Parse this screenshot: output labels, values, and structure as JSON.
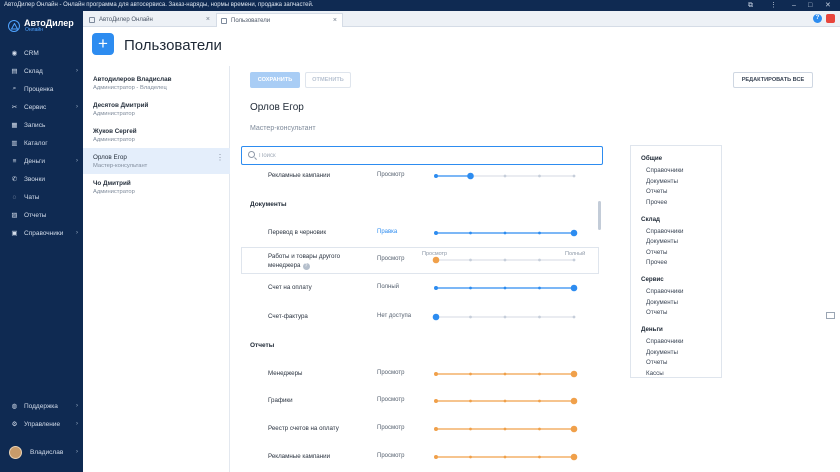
{
  "window": {
    "title": "АвтоДилер Онлайн - Онлайн программа для автосервиса. Заказ-наряды, нормы времени, продажа запчастей."
  },
  "tabs": [
    {
      "label": "АвтоДилер Онлайн",
      "active": false
    },
    {
      "label": "Пользователи",
      "active": true
    }
  ],
  "brand": {
    "name": "АвтоДилер",
    "sub": "Онлайн",
    "accent": "#2d8cf0",
    "sidebar_bg": "#0f2a52"
  },
  "sidebar": {
    "items": [
      {
        "label": "CRM",
        "icon": "eye-icon",
        "chevron": false
      },
      {
        "label": "Склад",
        "icon": "warehouse-icon",
        "chevron": true
      },
      {
        "label": "Проценка",
        "icon": "search-icon",
        "chevron": false
      },
      {
        "label": "Сервис",
        "icon": "wrench-icon",
        "chevron": true
      },
      {
        "label": "Запись",
        "icon": "calendar-icon",
        "chevron": false
      },
      {
        "label": "Каталог",
        "icon": "catalog-icon",
        "chevron": false
      },
      {
        "label": "Деньги",
        "icon": "money-icon",
        "chevron": true
      },
      {
        "label": "Звонки",
        "icon": "phone-icon",
        "chevron": false
      },
      {
        "label": "Чаты",
        "icon": "chat-icon",
        "chevron": false
      },
      {
        "label": "Отчеты",
        "icon": "chart-icon",
        "chevron": false
      },
      {
        "label": "Справочники",
        "icon": "book-icon",
        "chevron": true
      }
    ],
    "bottom": [
      {
        "label": "Поддержка",
        "icon": "support-icon",
        "chevron": true
      },
      {
        "label": "Управление",
        "icon": "gear-icon",
        "chevron": true
      }
    ],
    "user": {
      "name": "Владислав"
    }
  },
  "page": {
    "title": "Пользователи",
    "add_label": "+"
  },
  "users": [
    {
      "name": "Автодилеров Владислав",
      "role": "Администратор - Владелец",
      "active": false
    },
    {
      "name": "Десятов Дмитрий",
      "role": "Администратор",
      "active": false
    },
    {
      "name": "Жуков Сергей",
      "role": "Администратор",
      "active": false
    },
    {
      "name": "Орлов Егор",
      "role": "Мастер-консультант",
      "active": true
    },
    {
      "name": "Чо Дмитрий",
      "role": "Администратор",
      "active": false
    }
  ],
  "toolbar": {
    "save": "СОХРАНИТЬ",
    "cancel": "ОТМЕНИТЬ",
    "edit_all": "РЕДАКТИРОВАТЬ ВСЕ"
  },
  "employee": {
    "name": "Орлов Егор",
    "role": "Мастер-консультант"
  },
  "search": {
    "placeholder": "Поиск",
    "value": ""
  },
  "sections": {
    "documents": "Документы",
    "reports": "Отчеты"
  },
  "permission_scale": {
    "min_label": "Просмотр",
    "max_label": "Полный",
    "levels": 5,
    "blue": "#2d8cf0",
    "orange": "#f0a04a"
  },
  "permissions": [
    {
      "label": "Рекламные кампании",
      "level_label": "Просмотр",
      "level": 2,
      "color": "blue"
    },
    {
      "label": "Перевод в черновик",
      "level_label": "Правка",
      "level": 5,
      "color": "blue"
    },
    {
      "label": "Работы и товары другого менеджера",
      "level_label": "Просмотр",
      "level": 1,
      "color": "orange",
      "help": "?"
    },
    {
      "label": "Счет на оплату",
      "level_label": "Полный",
      "level": 5,
      "color": "blue"
    },
    {
      "label": "Счет-фактура",
      "level_label": "Нет доступа",
      "level": 1,
      "color": "blue"
    },
    {
      "label": "Менеджеры",
      "level_label": "Просмотр",
      "level": 5,
      "color": "orange"
    },
    {
      "label": "Графики",
      "level_label": "Просмотр",
      "level": 5,
      "color": "orange"
    },
    {
      "label": "Реестр счетов на оплату",
      "level_label": "Просмотр",
      "level": 5,
      "color": "orange"
    },
    {
      "label": "Рекламные кампании",
      "level_label": "Просмотр",
      "level": 5,
      "color": "orange"
    }
  ],
  "toc": [
    {
      "title": "Общие",
      "items": [
        "Справочники",
        "Документы",
        "Отчеты",
        "Прочее"
      ]
    },
    {
      "title": "Склад",
      "items": [
        "Справочники",
        "Документы",
        "Отчеты",
        "Прочее"
      ]
    },
    {
      "title": "Сервис",
      "items": [
        "Справочники",
        "Документы",
        "Отчеты"
      ]
    },
    {
      "title": "Деньги",
      "items": [
        "Справочники",
        "Документы",
        "Отчеты",
        "Кассы"
      ]
    }
  ]
}
